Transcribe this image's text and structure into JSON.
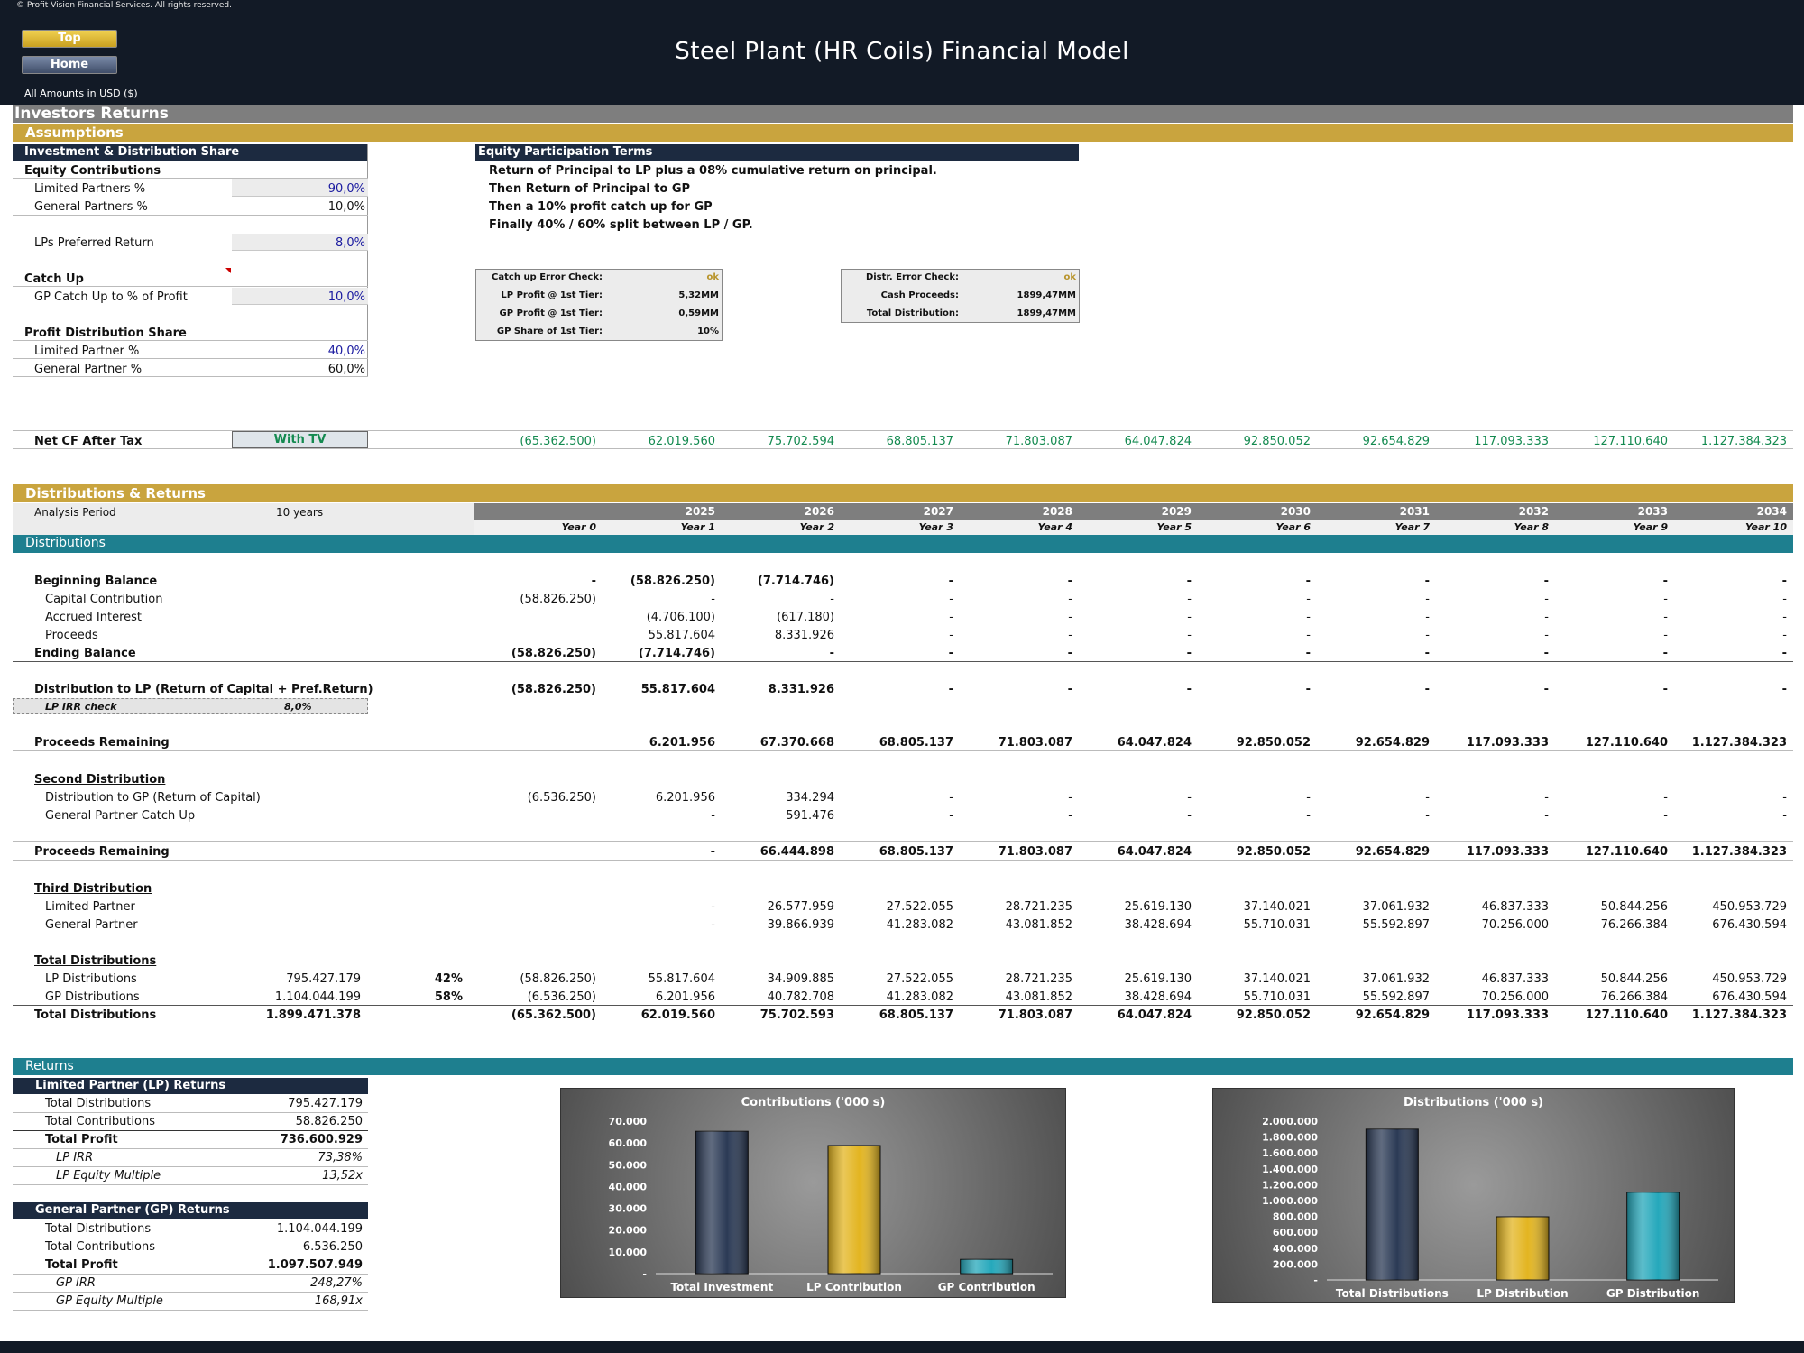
{
  "header": {
    "copyright": "© Profit Vision Financial Services. All rights reserved.",
    "btn_top": "Top",
    "btn_home": "Home",
    "title": "Steel Plant (HR Coils) Financial Model",
    "amounts": "All Amounts in  USD ($)"
  },
  "section_investors": "Investors Returns",
  "section_assumptions": "Assumptions",
  "investment": {
    "header": "Investment & Distribution Share",
    "equity_contrib": "Equity Contributions",
    "lp_pct_label": "Limited Partners %",
    "lp_pct": "90,0%",
    "gp_pct_label": "General Partners %",
    "gp_pct": "10,0%",
    "pref_label": "LPs Preferred Return",
    "pref": "8,0%",
    "catchup": "Catch Up",
    "catchup_label": "GP Catch Up to % of Profit",
    "catchup_val": "10,0%",
    "profit_share": "Profit Distribution Share",
    "lp_share_label": "Limited Partner %",
    "lp_share": "40,0%",
    "gp_share_label": "General Partner %",
    "gp_share": "60,0%"
  },
  "terms": {
    "header": "Equity Participation Terms",
    "lines": [
      "Return of Principal to LP plus a 08% cumulative return on principal.",
      "Then Return of Principal to GP",
      "Then a 10% profit catch up for GP",
      "Finally 40% / 60% split between LP / GP."
    ]
  },
  "check1": {
    "rows": [
      {
        "label": "Catch up Error Check:",
        "value": "ok"
      },
      {
        "label": "LP Profit @ 1st Tier:",
        "value": "5,32MM"
      },
      {
        "label": "GP Profit @ 1st Tier:",
        "value": "0,59MM"
      },
      {
        "label": "GP Share of 1st Tier:",
        "value": "10%"
      }
    ]
  },
  "check2": {
    "rows": [
      {
        "label": "Distr. Error Check:",
        "value": "ok"
      },
      {
        "label": "Cash Proceeds:",
        "value": "1899,47MM"
      },
      {
        "label": "Total Distribution:",
        "value": "1899,47MM"
      }
    ]
  },
  "netcf": {
    "label": "Net CF After Tax",
    "selector": "With TV",
    "values": [
      "(65.362.500)",
      "62.019.560",
      "75.702.594",
      "68.805.137",
      "71.803.087",
      "64.047.824",
      "92.850.052",
      "92.654.829",
      "117.093.333",
      "127.110.640",
      "1.127.384.323"
    ]
  },
  "section_dist_returns": "Distributions & Returns",
  "analysis": {
    "label": "Analysis Period",
    "value": "10 years"
  },
  "years": [
    "",
    "2025",
    "2026",
    "2027",
    "2028",
    "2029",
    "2030",
    "2031",
    "2032",
    "2033",
    "2034"
  ],
  "year_labels": [
    "Year 0",
    "Year 1",
    "Year 2",
    "Year 3",
    "Year 4",
    "Year 5",
    "Year 6",
    "Year 7",
    "Year 8",
    "Year 9",
    "Year 10"
  ],
  "section_distributions": "Distributions",
  "dist_rows": [
    {
      "label": "Beginning Balance",
      "style": "b",
      "indent": 0,
      "top": 637,
      "values": [
        "-",
        "(58.826.250)",
        "(7.714.746)",
        "-",
        "-",
        "-",
        "-",
        "-",
        "-",
        "-",
        "-"
      ]
    },
    {
      "label": "Capital Contribution",
      "style": "",
      "indent": 1,
      "top": 657,
      "values": [
        "(58.826.250)",
        "-",
        "-",
        "-",
        "-",
        "-",
        "-",
        "-",
        "-",
        "-",
        "-"
      ]
    },
    {
      "label": "Accrued Interest",
      "style": "",
      "indent": 1,
      "top": 677,
      "values": [
        "",
        "(4.706.100)",
        "(617.180)",
        "-",
        "-",
        "-",
        "-",
        "-",
        "-",
        "-",
        "-"
      ]
    },
    {
      "label": "Proceeds",
      "style": "",
      "indent": 1,
      "top": 697,
      "values": [
        "",
        "55.817.604",
        "8.331.926",
        "-",
        "-",
        "-",
        "-",
        "-",
        "-",
        "-",
        "-"
      ]
    },
    {
      "label": "Ending Balance",
      "style": "b",
      "indent": 0,
      "top": 717,
      "values": [
        "(58.826.250)",
        "(7.714.746)",
        "-",
        "-",
        "-",
        "-",
        "-",
        "-",
        "-",
        "-",
        "-"
      ]
    },
    {
      "label": "Distribution to LP (Return of Capital + Pref.Return)",
      "style": "b",
      "indent": 0,
      "top": 757,
      "values": [
        "(58.826.250)",
        "55.817.604",
        "8.331.926",
        "-",
        "-",
        "-",
        "-",
        "-",
        "-",
        "-",
        "-"
      ]
    },
    {
      "label": "Proceeds Remaining",
      "style": "b",
      "indent": 0,
      "top": 816,
      "values": [
        "",
        "6.201.956",
        "67.370.668",
        "68.805.137",
        "71.803.087",
        "64.047.824",
        "92.850.052",
        "92.654.829",
        "117.093.333",
        "127.110.640",
        "1.127.384.323"
      ]
    },
    {
      "label": "Distribution to GP (Return of Capital)",
      "style": "",
      "indent": 1,
      "top": 877,
      "values": [
        "(6.536.250)",
        "6.201.956",
        "334.294",
        "-",
        "-",
        "-",
        "-",
        "-",
        "-",
        "-",
        "-"
      ]
    },
    {
      "label": "General Partner Catch Up",
      "style": "",
      "indent": 1,
      "top": 897,
      "values": [
        "",
        "-",
        "591.476",
        "-",
        "-",
        "-",
        "-",
        "-",
        "-",
        "-",
        "-"
      ]
    },
    {
      "label": "Proceeds Remaining",
      "style": "b",
      "indent": 0,
      "top": 937,
      "values": [
        "",
        "-",
        "66.444.898",
        "68.805.137",
        "71.803.087",
        "64.047.824",
        "92.850.052",
        "92.654.829",
        "117.093.333",
        "127.110.640",
        "1.127.384.323"
      ]
    },
    {
      "label": "Limited Partner",
      "style": "",
      "indent": 1,
      "top": 998,
      "values": [
        "",
        "-",
        "26.577.959",
        "27.522.055",
        "28.721.235",
        "25.619.130",
        "37.140.021",
        "37.061.932",
        "46.837.333",
        "50.844.256",
        "450.953.729"
      ]
    },
    {
      "label": "General Partner",
      "style": "",
      "indent": 1,
      "top": 1018,
      "values": [
        "",
        "-",
        "39.866.939",
        "41.283.082",
        "43.081.852",
        "38.428.694",
        "55.710.031",
        "55.592.897",
        "70.256.000",
        "76.266.384",
        "676.430.594"
      ]
    },
    {
      "label": "LP Distributions",
      "style": "",
      "indent": 1,
      "top": 1078,
      "total": "795.427.179",
      "pct": "42%",
      "values": [
        "(58.826.250)",
        "55.817.604",
        "34.909.885",
        "27.522.055",
        "28.721.235",
        "25.619.130",
        "37.140.021",
        "37.061.932",
        "46.837.333",
        "50.844.256",
        "450.953.729"
      ]
    },
    {
      "label": "GP Distributions",
      "style": "",
      "indent": 1,
      "top": 1098,
      "total": "1.104.044.199",
      "pct": "58%",
      "values": [
        "(6.536.250)",
        "6.201.956",
        "40.782.708",
        "41.283.082",
        "43.081.852",
        "38.428.694",
        "55.710.031",
        "55.592.897",
        "70.256.000",
        "76.266.384",
        "676.430.594"
      ]
    },
    {
      "label": "Total Distributions",
      "style": "b",
      "indent": 0,
      "top": 1118,
      "total": "1.899.471.378",
      "pct": "",
      "values": [
        "(65.362.500)",
        "62.019.560",
        "75.702.593",
        "68.805.137",
        "71.803.087",
        "64.047.824",
        "92.850.052",
        "92.654.829",
        "117.093.333",
        "127.110.640",
        "1.127.384.323"
      ]
    }
  ],
  "lp_irr_check": {
    "label": "LP IRR check",
    "value": "8,0%"
  },
  "subheads": {
    "second": "Second Distribution",
    "third": "Third Distribution",
    "total": "Total Distributions"
  },
  "section_returns": "Returns",
  "lp_returns": {
    "header": "Limited Partner (LP) Returns",
    "rows": [
      {
        "label": "Total Distributions",
        "value": "795.427.179",
        "style": ""
      },
      {
        "label": "Total Contributions",
        "value": "58.826.250",
        "style": ""
      },
      {
        "label": "Total Profit",
        "value": "736.600.929",
        "style": "b"
      },
      {
        "label": "LP IRR",
        "value": "73,38%",
        "style": "i"
      },
      {
        "label": "LP Equity Multiple",
        "value": "13,52x",
        "style": "i"
      }
    ]
  },
  "gp_returns": {
    "header": "General Partner (GP) Returns",
    "rows": [
      {
        "label": "Total Distributions",
        "value": "1.104.044.199",
        "style": ""
      },
      {
        "label": "Total Contributions",
        "value": "6.536.250",
        "style": ""
      },
      {
        "label": "Total Profit",
        "value": "1.097.507.949",
        "style": "b"
      },
      {
        "label": "GP IRR",
        "value": "248,27%",
        "style": "i"
      },
      {
        "label": "GP Equity Multiple",
        "value": "168,91x",
        "style": "i"
      }
    ]
  },
  "chart_data": [
    {
      "type": "bar",
      "title": "Contributions ('000 s)",
      "categories": [
        "Total Investment",
        "LP Contribution",
        "GP Contribution"
      ],
      "values": [
        65362.5,
        58826.25,
        6536.25
      ],
      "ylim": [
        0,
        70000
      ],
      "yticks": [
        "-",
        "10.000",
        "20.000",
        "30.000",
        "40.000",
        "50.000",
        "60.000",
        "70.000"
      ],
      "colors": [
        "#2b3a55",
        "#e3b521",
        "#25a8bb"
      ]
    },
    {
      "type": "bar",
      "title": "Distributions ('000 s)",
      "categories": [
        "Total Distributions",
        "LP Distribution",
        "GP Distribution"
      ],
      "values": [
        1899471.378,
        795427.179,
        1104044.199
      ],
      "ylim": [
        0,
        2000000
      ],
      "yticks": [
        "-",
        "200.000",
        "400.000",
        "600.000",
        "800.000",
        "1.000.000",
        "1.200.000",
        "1.400.000",
        "1.600.000",
        "1.800.000",
        "2.000.000"
      ],
      "colors": [
        "#2b3a55",
        "#e3b521",
        "#25a8bb"
      ]
    }
  ]
}
